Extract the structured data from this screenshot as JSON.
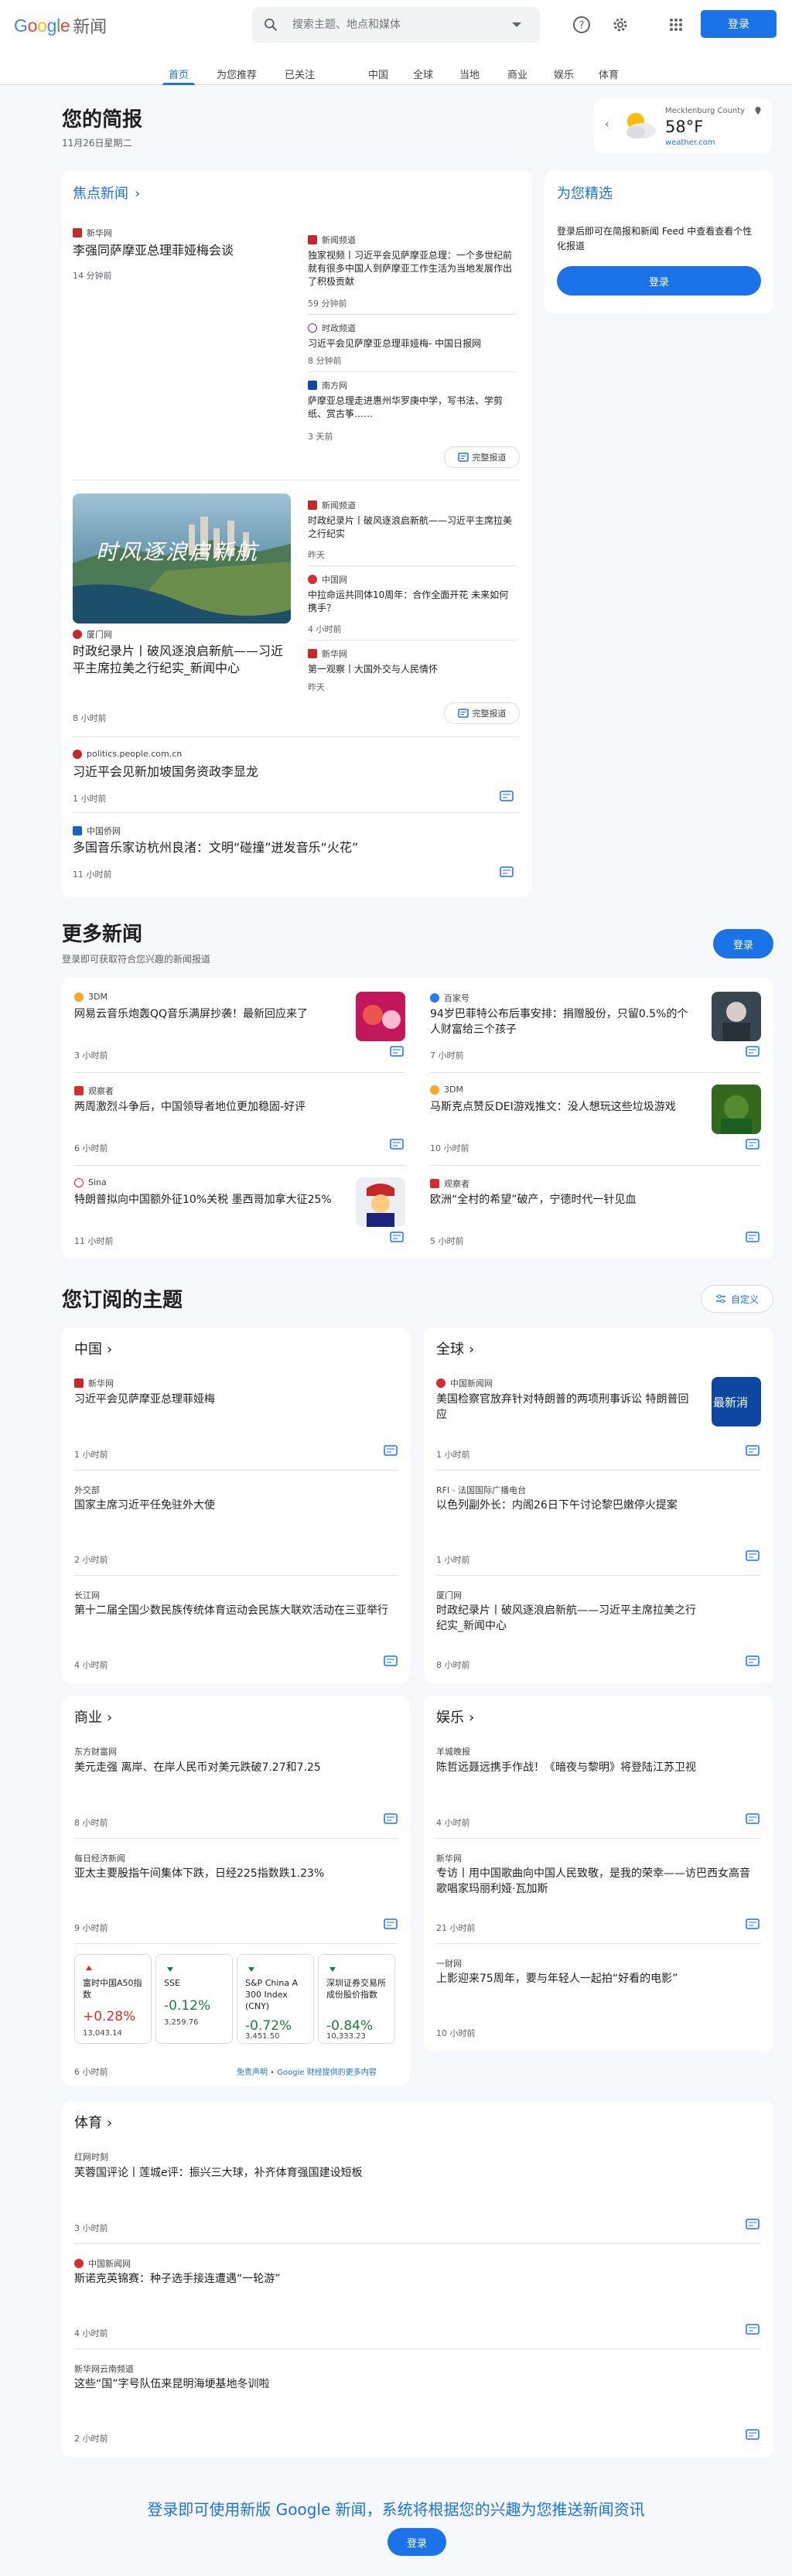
{
  "header": {
    "logo_google": "Google",
    "logo_news": "新闻",
    "search_placeholder": "搜索主题、地点和媒体",
    "signin": "登录"
  },
  "nav": [
    "首页",
    "为您推荐",
    "已关注",
    "中国",
    "全球",
    "当地",
    "商业",
    "娱乐",
    "体育"
  ],
  "briefing": {
    "title": "您的简报",
    "date": "11月26日星期二"
  },
  "weather": {
    "location": "Mecklenburg County",
    "temp": "58°F",
    "source": "weather.com"
  },
  "top": {
    "heading": "焦点新闻",
    "s1": {
      "source": "新华网",
      "title": "李强同萨摩亚总理菲娅梅会谈",
      "time": "14 分钟前",
      "related": [
        {
          "source": "新闻频道",
          "title": "独家视频丨习近平会见萨摩亚总理：一个多世纪前就有很多中国人到萨摩亚工作生活为当地发展作出了积极贡献",
          "time": "59 分钟前"
        },
        {
          "source": "时政频道",
          "title": "习近平会见萨摩亚总理菲娅梅- 中国日报网",
          "time": "8 分钟前"
        },
        {
          "source": "南方网",
          "title": "萨摩亚总理走进惠州华罗庚中学，写书法、学剪纸、赏古筝……",
          "time": "3 天前"
        }
      ],
      "coverage": "完整报道"
    },
    "s2": {
      "image_text": "时风逐浪启新航",
      "source": "厦门网",
      "title": "时政纪录片丨破风逐浪启新航——习近平主席拉美之行纪实_新闻中心",
      "time": "8 小时前",
      "related": [
        {
          "source": "新闻频道",
          "title": "时政纪录片丨破风逐浪启新航——习近平主席拉美之行纪实",
          "time": "昨天"
        },
        {
          "source": "中国网",
          "title": "中拉命运共同体10周年：合作全面开花 未来如何携手？",
          "time": "4 小时前"
        },
        {
          "source": "新华网",
          "title": "第一观察丨大国外交与人民情怀",
          "time": "昨天"
        }
      ],
      "coverage": "完整报道"
    },
    "s3": {
      "source": "politics.people.com.cn",
      "title": "习近平会见新加坡国务资政李显龙",
      "time": "1 小时前"
    },
    "s4": {
      "source": "中国侨网",
      "title": "多国音乐家访杭州良渚：文明“碰撞”迸发音乐“火花”",
      "time": "11 小时前"
    }
  },
  "picks": {
    "heading": "为您精选",
    "text": "登录后即可在简报和新闻 Feed 中查看查看个性化报道",
    "button": "登录"
  },
  "more": {
    "title": "更多新闻",
    "subtitle": "登录即可获取符合您兴趣的新闻报道",
    "button": "登录",
    "items": [
      {
        "source": "3DM",
        "title": "网易云音乐炮轰QQ音乐满屏抄袭！最新回应来了",
        "time": "3 小时前"
      },
      {
        "source": "百家号",
        "title": "94岁巴菲特公布后事安排：捐赠股份，只留0.5%的个人财富给三个孩子",
        "time": "7 小时前"
      },
      {
        "source": "观察者",
        "title": "两周激烈斗争后，中国领导者地位更加稳固-好评",
        "time": "6 小时前"
      },
      {
        "source": "3DM",
        "title": "马斯克点赞反DEI游戏推文：没人想玩这些垃圾游戏",
        "time": "10 小时前"
      },
      {
        "source": "Sina",
        "title": "特朗普拟向中国额外征10%关税 墨西哥加拿大征25%",
        "time": "11 小时前"
      },
      {
        "source": "观察者",
        "title": "欧洲“全村的希望”破产，宁德时代一针见血",
        "time": "5 小时前"
      }
    ]
  },
  "topics": {
    "title": "您订阅的主题",
    "customize": "自定义",
    "china": {
      "heading": "中国",
      "items": [
        {
          "source": "新华网",
          "title": "习近平会见萨摩亚总理菲娅梅",
          "time": "1 小时前"
        },
        {
          "source": "外交部",
          "title": "国家主席习近平任免驻外大使",
          "time": "2 小时前"
        },
        {
          "source": "长江网",
          "title": "第十二届全国少数民族传统体育运动会民族大联欢活动在三亚举行",
          "time": "4 小时前"
        }
      ]
    },
    "world": {
      "heading": "全球",
      "items": [
        {
          "source": "中国新闻网",
          "title": "美国检察官放弃针对特朗普的两项刑事诉讼 特朗普回应",
          "time": "1 小时前",
          "thumb": "最新消"
        },
        {
          "source": "RFI - 法国国际广播电台",
          "title": "以色列副外长：内阁26日下午讨论黎巴嫩停火提案",
          "time": "1 小时前"
        },
        {
          "source": "厦门网",
          "title": "时政纪录片丨破风逐浪启新航——习近平主席拉美之行纪实_新闻中心",
          "time": "8 小时前"
        }
      ]
    },
    "business": {
      "heading": "商业",
      "items": [
        {
          "source": "东方财富网",
          "title": "美元走强 离岸、在岸人民币对美元跌破7.27和7.25",
          "time": "8 小时前"
        },
        {
          "source": "每日经济新闻",
          "title": "亚太主要股指午间集体下跌，日经225指数跌1.23%",
          "time": "9 小时前"
        }
      ],
      "stocks": [
        {
          "name": "富时中国A50指数",
          "pct": "+0.28%",
          "val": "13,043.14",
          "up": true
        },
        {
          "name": "SSE",
          "pct": "-0.12%",
          "val": "3,259.76",
          "up": false
        },
        {
          "name": "S&P China A 300 Index (CNY)",
          "pct": "-0.72%",
          "val": "3,451.50",
          "up": false
        },
        {
          "name": "深圳证券交易所成份股价指数",
          "pct": "-0.84%",
          "val": "10,333.23",
          "up": false
        }
      ],
      "stocks_time": "6 小时前",
      "disclaimer": "免责声明 • Google 财经提供的更多内容"
    },
    "ent": {
      "heading": "娱乐",
      "items": [
        {
          "source": "羊城晚报",
          "title": "陈哲远聂远携手作战！《暗夜与黎明》将登陆江苏卫视",
          "time": "4 小时前"
        },
        {
          "source": "新华网",
          "title": "专访丨用中国歌曲向中国人民致敬，是我的荣幸——访巴西女高音歌唱家玛丽利娅·瓦加斯",
          "time": "21 小时前"
        },
        {
          "source": "一财网",
          "title": "上影迎来75周年，要与年轻人一起拍“好看的电影”",
          "time": "10 小时前"
        }
      ]
    },
    "sports": {
      "heading": "体育",
      "items": [
        {
          "source": "红网时刻",
          "title": "芙蓉国评论丨莲城e评：振兴三大球，补齐体育强国建设短板",
          "time": "3 小时前"
        },
        {
          "source": "中国新闻网",
          "title": "斯诺克英锦赛：种子选手接连遭遇“一轮游”",
          "time": "4 小时前"
        },
        {
          "source": "新华网云南频道",
          "title": "这些“国”字号队伍来昆明海埂基地冬训啦",
          "time": "2 小时前"
        }
      ]
    }
  },
  "footer": {
    "text": "登录即可使用新版 Google 新闻，系统将根据您的兴趣为您推送新闻资讯",
    "button": "登录"
  },
  "colors": {
    "accent": "#1a73e8",
    "up": "#d93025",
    "down": "#188038"
  }
}
